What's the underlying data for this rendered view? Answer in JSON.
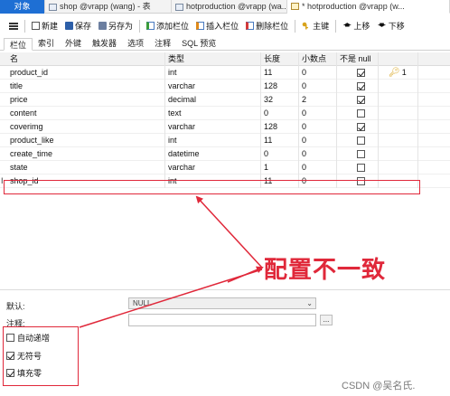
{
  "tabs": [
    {
      "label": "对象"
    },
    {
      "label": "shop @vrapp (wang) - 表"
    },
    {
      "label": "hotproduction @vrapp (wa..."
    },
    {
      "label": "* hotproduction @vrapp (w..."
    }
  ],
  "toolbar": {
    "new": "新建",
    "save": "保存",
    "save_as": "另存为",
    "add_field": "添加栏位",
    "insert_field": "插入栏位",
    "delete_field": "删除栏位",
    "primary_key": "主键",
    "move_up": "上移",
    "move_down": "下移"
  },
  "subtabs": [
    "栏位",
    "索引",
    "外键",
    "触发器",
    "选项",
    "注释",
    "SQL 预览"
  ],
  "columns": {
    "name": "名",
    "type": "类型",
    "length": "长度",
    "decimals": "小数点",
    "not_null": "不是 null"
  },
  "rows": [
    {
      "name": "product_id",
      "type": "int",
      "length": "11",
      "decimals": "0",
      "not_null": true,
      "key": "1"
    },
    {
      "name": "title",
      "type": "varchar",
      "length": "128",
      "decimals": "0",
      "not_null": true,
      "key": ""
    },
    {
      "name": "price",
      "type": "decimal",
      "length": "32",
      "decimals": "2",
      "not_null": true,
      "key": ""
    },
    {
      "name": "content",
      "type": "text",
      "length": "0",
      "decimals": "0",
      "not_null": false,
      "key": ""
    },
    {
      "name": "coverimg",
      "type": "varchar",
      "length": "128",
      "decimals": "0",
      "not_null": true,
      "key": ""
    },
    {
      "name": "product_like",
      "type": "int",
      "length": "11",
      "decimals": "0",
      "not_null": false,
      "key": ""
    },
    {
      "name": "create_time",
      "type": "datetime",
      "length": "0",
      "decimals": "0",
      "not_null": false,
      "key": ""
    },
    {
      "name": "state",
      "type": "varchar",
      "length": "1",
      "decimals": "0",
      "not_null": false,
      "key": ""
    },
    {
      "name": "shop_id",
      "type": "int",
      "length": "11",
      "decimals": "0",
      "not_null": false,
      "key": ""
    }
  ],
  "current_row_marker": "I",
  "properties": {
    "default_label": "默认:",
    "default_value": "NULL",
    "comment_label": "注释:",
    "ellipsis": "...",
    "options": [
      {
        "label": "自动递增",
        "checked": false
      },
      {
        "label": "无符号",
        "checked": true
      },
      {
        "label": "填充零",
        "checked": true
      }
    ]
  },
  "annotation": "配置不一致",
  "watermark": "CSDN @吴名氏.",
  "colors": {
    "accent": "#1e6fd4",
    "annotation": "#e0283a",
    "key": "#d8a31b"
  }
}
